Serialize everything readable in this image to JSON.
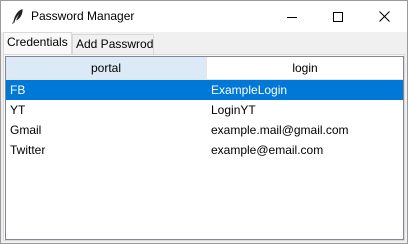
{
  "window": {
    "title": "Password Manager",
    "icons": {
      "app": "feather-icon",
      "minimize": "minimize-icon",
      "maximize": "maximize-icon",
      "close": "close-icon"
    }
  },
  "tabs": [
    {
      "label": "Credentials",
      "active": true
    },
    {
      "label": "Add Passwrod",
      "active": false
    }
  ],
  "table": {
    "columns": [
      "portal",
      "login"
    ],
    "rows": [
      {
        "portal": "FB",
        "login": "ExampleLogin",
        "selected": true
      },
      {
        "portal": "YT",
        "login": "LoginYT",
        "selected": false
      },
      {
        "portal": "Gmail",
        "login": "example.mail@gmail.com",
        "selected": false
      },
      {
        "portal": "Twitter",
        "login": "example@email.com",
        "selected": false
      }
    ]
  },
  "colors": {
    "selection": "#0078d7",
    "header_hover": "#dceaf7"
  }
}
